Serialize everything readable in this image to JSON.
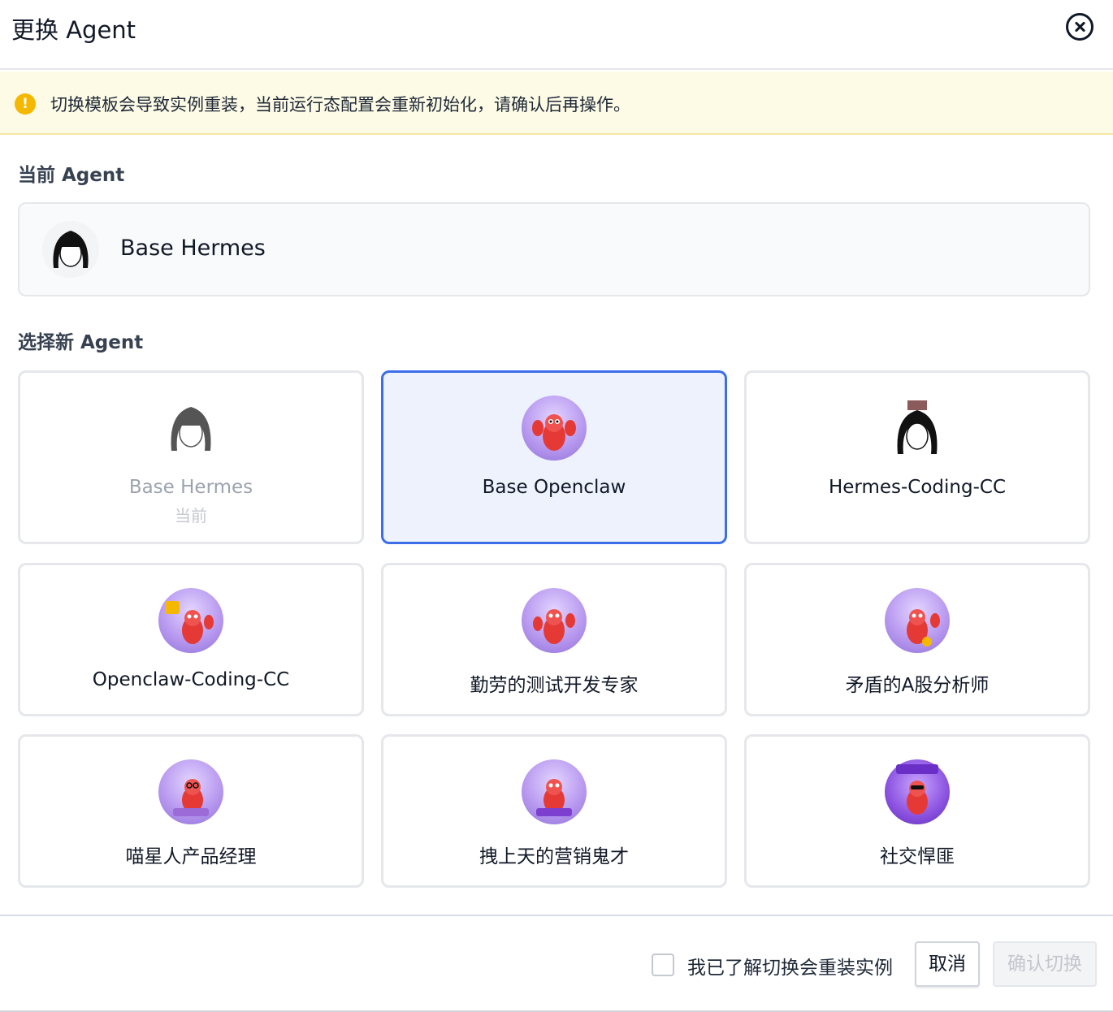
{
  "dialog": {
    "title": "更换 Agent"
  },
  "warning": {
    "text": "切换模板会导致实例重装，当前运行态配置会重新初始化，请确认后再操作。",
    "icon": "exclamation-icon",
    "color": "#f5b800"
  },
  "current": {
    "section_label": "当前 Agent",
    "name": "Base Hermes"
  },
  "select": {
    "section_label": "选择新 Agent",
    "agents": [
      {
        "name": "Base Hermes",
        "sub": "当前",
        "state": "disabled"
      },
      {
        "name": "Base Openclaw",
        "sub": "",
        "state": "selected"
      },
      {
        "name": "Hermes-Coding-CC",
        "sub": "",
        "state": "normal"
      },
      {
        "name": "Openclaw-Coding-CC",
        "sub": "",
        "state": "normal"
      },
      {
        "name": "勤劳的测试开发专家",
        "sub": "",
        "state": "normal"
      },
      {
        "name": "矛盾的A股分析师",
        "sub": "",
        "state": "normal"
      },
      {
        "name": "喵星人产品经理",
        "sub": "",
        "state": "normal"
      },
      {
        "name": "拽上天的营销鬼才",
        "sub": "",
        "state": "normal"
      },
      {
        "name": "社交悍匪",
        "sub": "",
        "state": "normal"
      }
    ]
  },
  "footer": {
    "ack_label": "我已了解切换会重装实例",
    "ack_checked": false,
    "cancel_label": "取消",
    "confirm_label": "确认切换"
  },
  "colors": {
    "selected_border": "#3b6ee8",
    "selected_bg": "#edf2fd",
    "warning_bg": "#fdfbe6"
  }
}
